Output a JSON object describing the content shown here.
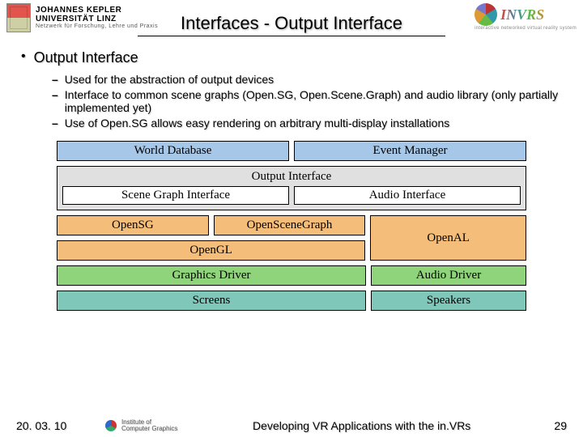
{
  "header": {
    "uni_line1": "JOHANNES KEPLER",
    "uni_line2": "UNIVERSITÄT LINZ",
    "uni_sub": "Netzwerk für Forschung, Lehre und Praxis",
    "invrs_name": "INVRS",
    "invrs_sub": "interactive networked virtual reality system"
  },
  "title": "Interfaces - Output Interface",
  "bullets": {
    "lvl1": "Output Interface",
    "lvl2a": "Used for the abstraction of output devices",
    "lvl2b": "Interface to common scene graphs (Open.SG, Open.Scene.Graph) and audio library (only partially implemented yet)",
    "lvl2c": "Use of Open.SG allows easy rendering on arbitrary multi-display installations"
  },
  "diagram": {
    "world_db": "World Database",
    "event_mgr": "Event Manager",
    "out_iface": "Output Interface",
    "sg_iface": "Scene Graph Interface",
    "audio_iface": "Audio Interface",
    "opensg": "OpenSG",
    "openscenegraph": "OpenSceneGraph",
    "opengl": "OpenGL",
    "openal": "OpenAL",
    "gfx_driver": "Graphics Driver",
    "audio_driver": "Audio Driver",
    "screens": "Screens",
    "speakers": "Speakers"
  },
  "footer": {
    "date": "20. 03. 10",
    "inst1": "Institute of",
    "inst2": "Computer Graphics",
    "title": "Developing VR Applications with the in.VRs",
    "page": "29"
  }
}
